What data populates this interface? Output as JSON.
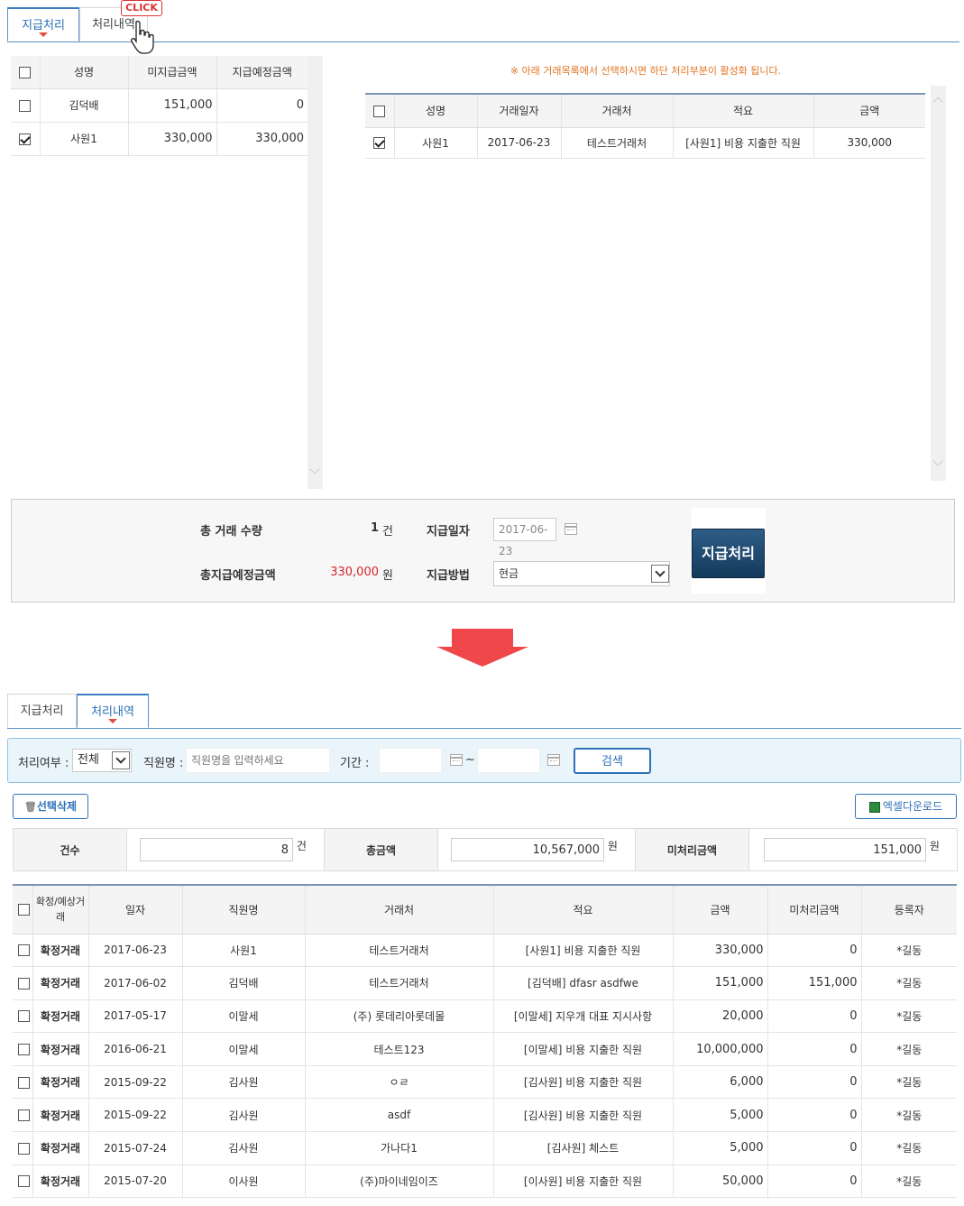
{
  "tabs": {
    "pay": "지급처리",
    "history": "처리내역",
    "click": "CLICK"
  },
  "notice": "※ 아래 거래목록에서 선택하시면 하단 처리부분이 활성화 됩니다.",
  "employee_grid": {
    "headers": [
      "성명",
      "미지급금액",
      "지급예정금액"
    ],
    "rows": [
      {
        "checked": false,
        "name": "김덕배",
        "unpaid": "151,000",
        "planned": "0"
      },
      {
        "checked": true,
        "name": "사원1",
        "unpaid": "330,000",
        "planned": "330,000"
      }
    ]
  },
  "transaction_grid": {
    "headers": [
      "성명",
      "거래일자",
      "거래처",
      "적요",
      "금액"
    ],
    "rows": [
      {
        "checked": true,
        "name": "사원1",
        "date": "2017-06-23",
        "vendor": "테스트거래처",
        "memo": "[사원1] 비용 지출한 직원",
        "amount": "330,000"
      }
    ]
  },
  "summary": {
    "count_label": "총 거래 수량",
    "count_value": "1",
    "count_unit": "건",
    "total_label": "총지급예정금액",
    "total_value": "330,000",
    "total_unit": "원",
    "date_label": "지급일자",
    "date_value": "2017-06-23",
    "method_label": "지급방법",
    "method_value": "현금",
    "pay_button": "지급처리"
  },
  "search": {
    "status_label": "처리여부 :",
    "status_value": "전체",
    "name_label": "직원명 :",
    "name_placeholder": "직원명을 입력하세요",
    "period_label": "기간 :",
    "tilde": "~",
    "search_button": "검색"
  },
  "actions": {
    "delete_button": "선택삭제",
    "excel_button": "엑셀다운로드"
  },
  "totals": {
    "count_label": "건수",
    "count_value": "8",
    "count_unit": "건",
    "amount_label": "총금액",
    "amount_value": "10,567,000",
    "amount_unit": "원",
    "unprocessed_label": "미처리금액",
    "unprocessed_value": "151,000",
    "unprocessed_unit": "원"
  },
  "history_grid": {
    "headers": [
      "확정/예상거래",
      "일자",
      "직원명",
      "거래처",
      "적요",
      "금액",
      "미처리금액",
      "등록자"
    ],
    "rows": [
      {
        "type": "확정거래",
        "date": "2017-06-23",
        "employee": "사원1",
        "vendor": "테스트거래처",
        "memo": "[사원1] 비용 지출한 직원",
        "amount": "330,000",
        "unprocessed": "0",
        "registrant": "*길동"
      },
      {
        "type": "확정거래",
        "date": "2017-06-02",
        "employee": "김덕배",
        "vendor": "테스트거래처",
        "memo": "[김덕배] dfasr asdfwe",
        "amount": "151,000",
        "unprocessed": "151,000",
        "registrant": "*길동"
      },
      {
        "type": "확정거래",
        "date": "2017-05-17",
        "employee": "이말세",
        "vendor": "(주) 롯데리아롯데몰",
        "memo": "[이말세] 지우개 대표 지시사항",
        "amount": "20,000",
        "unprocessed": "0",
        "registrant": "*길동"
      },
      {
        "type": "확정거래",
        "date": "2016-06-21",
        "employee": "이말세",
        "vendor": "테스트123",
        "memo": "[이말세] 비용 지출한 직원",
        "amount": "10,000,000",
        "unprocessed": "0",
        "registrant": "*길동"
      },
      {
        "type": "확정거래",
        "date": "2015-09-22",
        "employee": "김사원",
        "vendor": "ㅇㄹ",
        "memo": "[김사원] 비용 지출한 직원",
        "amount": "6,000",
        "unprocessed": "0",
        "registrant": "*길동"
      },
      {
        "type": "확정거래",
        "date": "2015-09-22",
        "employee": "김사원",
        "vendor": "asdf",
        "memo": "[김사원] 비용 지출한 직원",
        "amount": "5,000",
        "unprocessed": "0",
        "registrant": "*길동"
      },
      {
        "type": "확정거래",
        "date": "2015-07-24",
        "employee": "김사원",
        "vendor": "가나다1",
        "memo": "[김사원] 체스트",
        "amount": "5,000",
        "unprocessed": "0",
        "registrant": "*길동"
      },
      {
        "type": "확정거래",
        "date": "2015-07-20",
        "employee": "이사원",
        "vendor": "(주)마이네임이즈",
        "memo": "[이사원] 비용 지출한 직원",
        "amount": "50,000",
        "unprocessed": "0",
        "registrant": "*길동"
      }
    ]
  }
}
